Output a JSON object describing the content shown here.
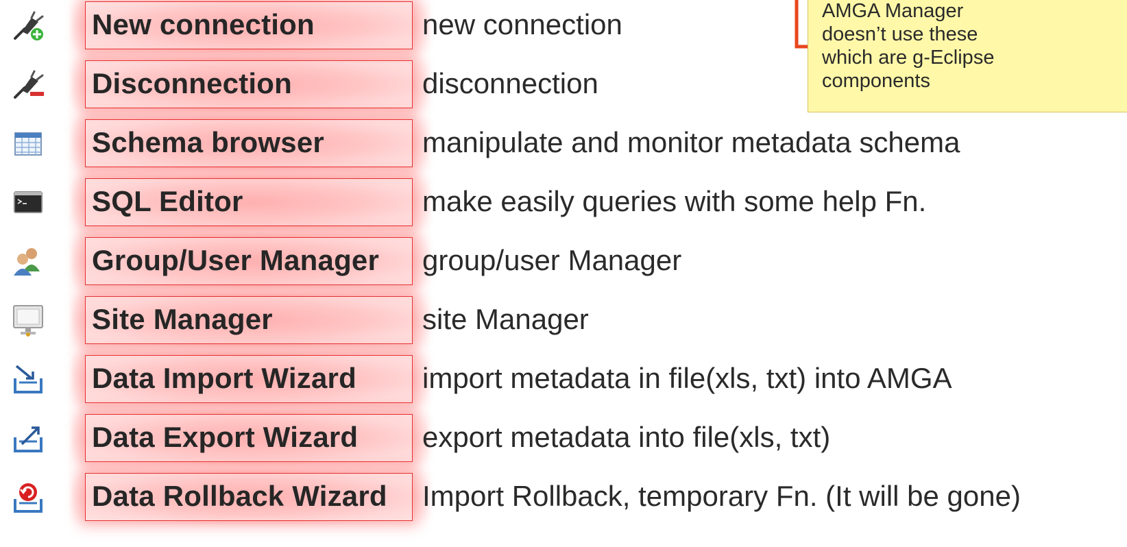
{
  "items": [
    {
      "icon": "plug-add-icon",
      "label": "New connection",
      "description": "new connection"
    },
    {
      "icon": "plug-remove-icon",
      "label": "Disconnection",
      "description": "disconnection"
    },
    {
      "icon": "table-icon",
      "label": "Schema browser",
      "description": "manipulate and monitor metadata schema"
    },
    {
      "icon": "terminal-icon",
      "label": "SQL Editor",
      "description": "make easily queries with some help Fn."
    },
    {
      "icon": "users-icon",
      "label": "Group/User Manager",
      "description": "group/user Manager"
    },
    {
      "icon": "computer-icon",
      "label": "Site Manager",
      "description": "site Manager"
    },
    {
      "icon": "import-icon",
      "label": "Data Import Wizard",
      "description": "import metadata in file(xls, txt) into AMGA"
    },
    {
      "icon": "export-icon",
      "label": "Data Export Wizard",
      "description": "export metadata into file(xls, txt)"
    },
    {
      "icon": "rollback-icon",
      "label": "Data Rollback Wizard",
      "description": "Import Rollback, temporary Fn. (It will be gone)"
    }
  ],
  "note": {
    "lines": [
      "AMGA Manager",
      "doesn’t use these",
      "which are g-Eclipse",
      "components"
    ]
  },
  "colors": {
    "highlight_border": "#e53030",
    "note_background": "#fff8a8",
    "arrow": "#e8461e"
  }
}
